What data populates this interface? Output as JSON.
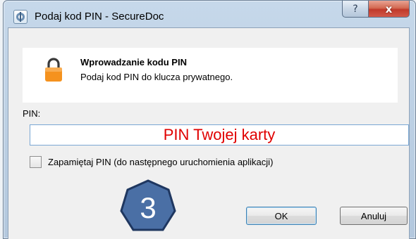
{
  "window": {
    "title": "Podaj kod PIN - SecureDoc",
    "help_label": "?",
    "close_label": "x"
  },
  "header": {
    "title": "Wprowadzanie kodu PIN",
    "subtitle": "Podaj kod PIN do klucza prywatnego."
  },
  "form": {
    "pin_label": "PIN:",
    "pin_value": "PIN Twojej karty",
    "remember_label": "Zapamiętaj PIN (do następnego uruchomienia aplikacji)",
    "remember_checked": false
  },
  "annotation": {
    "step_number": "3"
  },
  "buttons": {
    "ok_label": "OK",
    "cancel_label": "Anuluj"
  },
  "colors": {
    "pin_text": "#e00000",
    "badge_fill": "#4a6fa5",
    "badge_border": "#1f3760",
    "lock_body": "#f5921e",
    "close_button": "#c0392b"
  }
}
